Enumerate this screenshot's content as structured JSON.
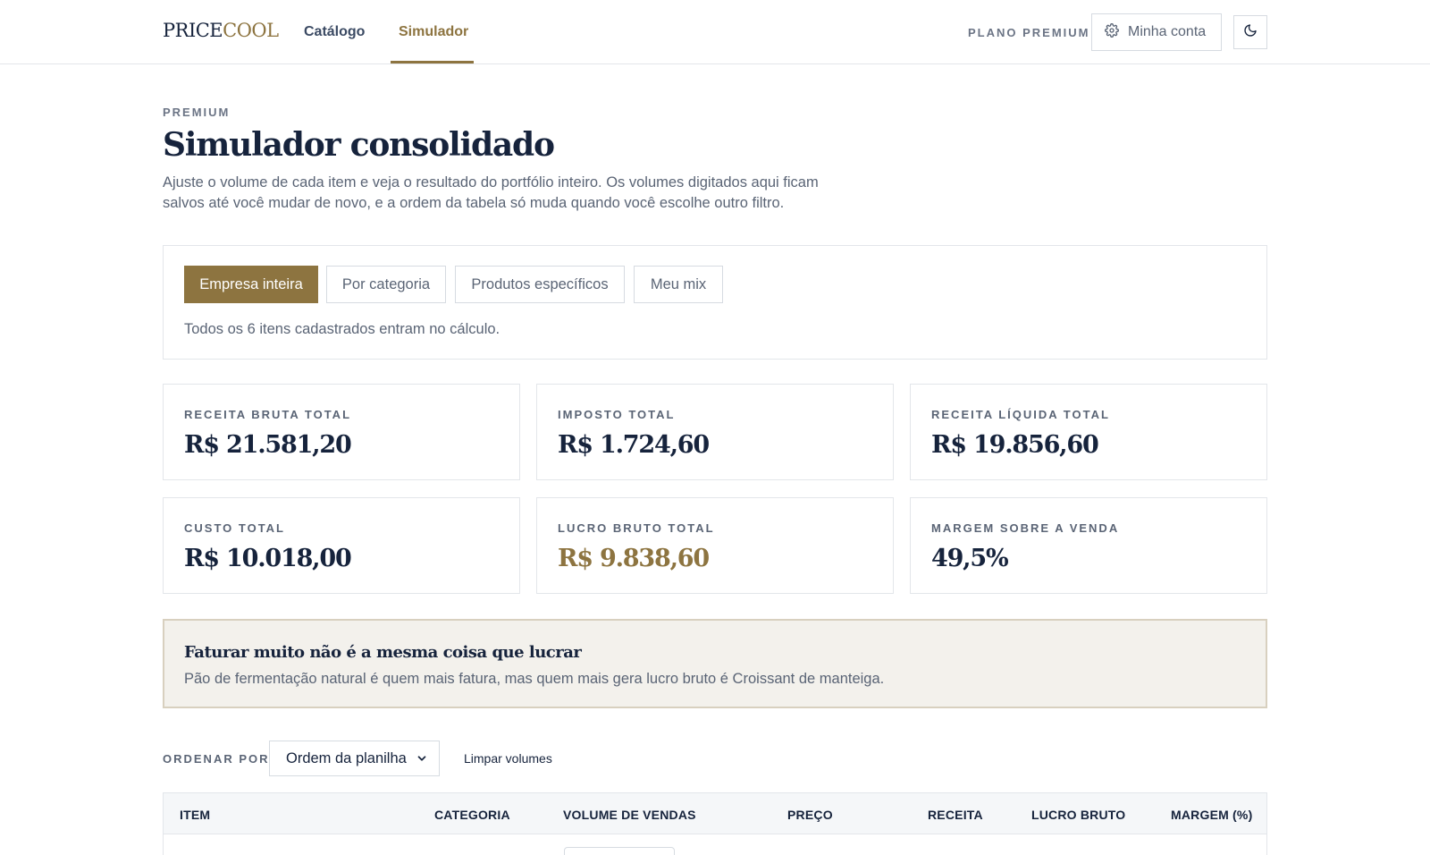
{
  "header": {
    "logo_part1": "PRICE",
    "logo_part2": "COOL",
    "nav": [
      {
        "label": "Catálogo"
      },
      {
        "label": "Simulador"
      }
    ],
    "plan_label": "PLANO PREMIUM",
    "account_label": "Minha conta"
  },
  "intro": {
    "eyebrow": "PREMIUM",
    "title": "Simulador consolidado",
    "description": "Ajuste o volume de cada item e veja o resultado do portfólio inteiro. Os volumes digitados aqui ficam salvos até você mudar de novo, e a ordem da tabela só muda quando você escolhe outro filtro."
  },
  "filters": {
    "options": [
      {
        "label": "Empresa inteira"
      },
      {
        "label": "Por categoria"
      },
      {
        "label": "Produtos específicos"
      },
      {
        "label": "Meu mix"
      }
    ],
    "note": "Todos os 6 itens cadastrados entram no cálculo."
  },
  "metrics": [
    {
      "label": "RECEITA BRUTA TOTAL",
      "value": "R$ 21.581,20"
    },
    {
      "label": "IMPOSTO TOTAL",
      "value": "R$ 1.724,60"
    },
    {
      "label": "RECEITA LÍQUIDA TOTAL",
      "value": "R$ 19.856,60"
    },
    {
      "label": "CUSTO TOTAL",
      "value": "R$ 10.018,00"
    },
    {
      "label": "LUCRO BRUTO TOTAL",
      "value": "R$ 9.838,60"
    },
    {
      "label": "MARGEM SOBRE A VENDA",
      "value": "49,5%"
    }
  ],
  "insight": {
    "title": "Faturar muito não é a mesma coisa que lucrar",
    "text": "Pão de fermentação natural é quem mais fatura, mas quem mais gera lucro bruto é Croissant de manteiga."
  },
  "sort": {
    "label": "ORDENAR POR",
    "selected": "Ordem da planilha",
    "clear_label": "Limpar volumes"
  },
  "table": {
    "columns": [
      "ITEM",
      "CATEGORIA",
      "VOLUME DE VENDAS",
      "PREÇO",
      "RECEITA",
      "LUCRO BRUTO",
      "MARGEM (%)"
    ]
  },
  "colors": {
    "accent": "#8d7440",
    "navy": "#16233c",
    "muted": "#5a6475",
    "insight_bg": "#f3f1ec"
  }
}
